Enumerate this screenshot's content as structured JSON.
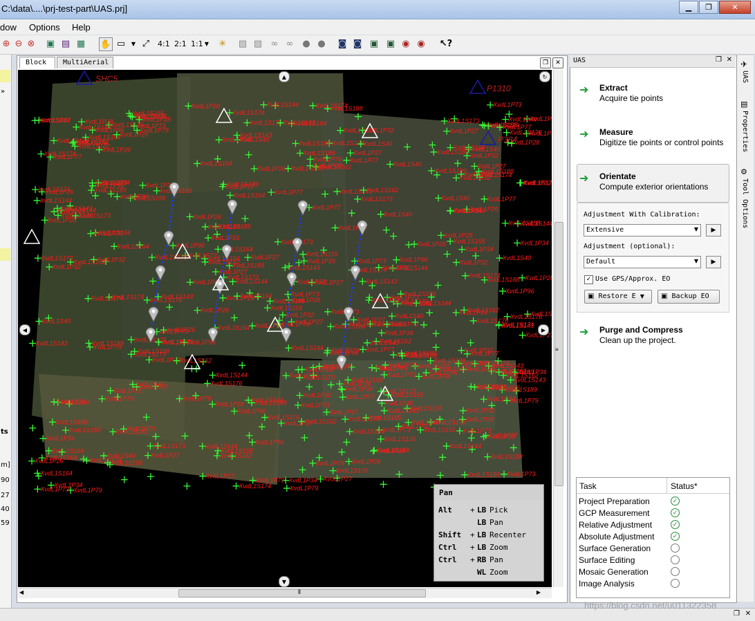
{
  "window": {
    "title": "C:\\data\\....\\prj-test-part\\UAS.prj]"
  },
  "menu": {
    "items": [
      "dow",
      "Options",
      "Help"
    ]
  },
  "toolbar": {
    "zoom_4_1": "4:1",
    "zoom_2_1": "2:1",
    "zoom_1_1": "1:1"
  },
  "tabs": [
    {
      "label": "Block"
    },
    {
      "label": "MultiAerial"
    }
  ],
  "map": {
    "ground_points": [
      "SHC5",
      "P1310",
      "P384"
    ],
    "tie_labels": [
      "XvdL1P26",
      "XvdL1P27",
      "XvdL1P32",
      "XvdL1P28",
      "XvdL1S40",
      "XvdL1P73",
      "XvdL1S174",
      "XvdL1S188",
      "XvdL1S162",
      "XvdL1P79",
      "XvdL1P77",
      "XvdL1S164",
      "XvdL1S176",
      "XvdL1P34",
      "XvdL1S144",
      "XvdL1S143",
      "XvdL1S189",
      "XvdL1S173",
      "XvdL1S155",
      "XvdL1P96"
    ]
  },
  "legend": {
    "title": "Pan",
    "rows": [
      {
        "key": "Alt",
        "plus": "+",
        "button": "LB",
        "action": "Pick"
      },
      {
        "key": "",
        "plus": "",
        "button": "LB",
        "action": "Pan"
      },
      {
        "key": "Shift",
        "plus": "+",
        "button": "LB",
        "action": "Recenter"
      },
      {
        "key": "Ctrl",
        "plus": "+",
        "button": "LB",
        "action": "Zoom"
      },
      {
        "key": "Ctrl",
        "plus": "+",
        "button": "RB",
        "action": "Pan"
      },
      {
        "key": "",
        "plus": "",
        "button": "WL",
        "action": "Zoom"
      }
    ]
  },
  "uas": {
    "panel_title": "UAS",
    "steps": [
      {
        "title": "Extract",
        "desc": "Acquire tie points"
      },
      {
        "title": "Measure",
        "desc": "Digitize tie points or control points"
      },
      {
        "title": "Orientate",
        "desc": "Compute exterior orientations"
      },
      {
        "title": "Purge and Compress",
        "desc": "Clean up the project."
      }
    ],
    "adj_calib_label": "Adjustment With Calibration:",
    "adj_calib_value": "Extensive",
    "adj_opt_label": "Adjustment (optional):",
    "adj_opt_value": "Default",
    "gps_label": "Use GPS/Approx. EO",
    "restore_label": "Restore E",
    "backup_label": "Backup EO"
  },
  "tasks": {
    "header_task": "Task",
    "header_status": "Status*",
    "rows": [
      {
        "name": "Project Preparation",
        "done": true
      },
      {
        "name": "GCP Measurement",
        "done": true
      },
      {
        "name": "Relative Adjustment",
        "done": true
      },
      {
        "name": "Absolute Adjustment",
        "done": true
      },
      {
        "name": "Surface Generation",
        "done": false
      },
      {
        "name": "Surface Editing",
        "done": false
      },
      {
        "name": "Mosaic Generation",
        "done": false
      },
      {
        "name": "Image Analysis",
        "done": false
      }
    ]
  },
  "side_tabs": [
    "UAS",
    "Properties",
    "Tool Options"
  ],
  "left_fragments": [
    "»",
    "ts",
    "m]",
    "90",
    "27",
    "40",
    "59"
  ],
  "watermark": "https://blog.csdn.net/u011322358",
  "colors": {
    "tie_label": "#ff1a1a",
    "tie_cross": "#33ff33",
    "gcp_triangle": "#ffffff",
    "ground_triangle": "#1a1aa8",
    "track_line": "#1a3cff"
  }
}
